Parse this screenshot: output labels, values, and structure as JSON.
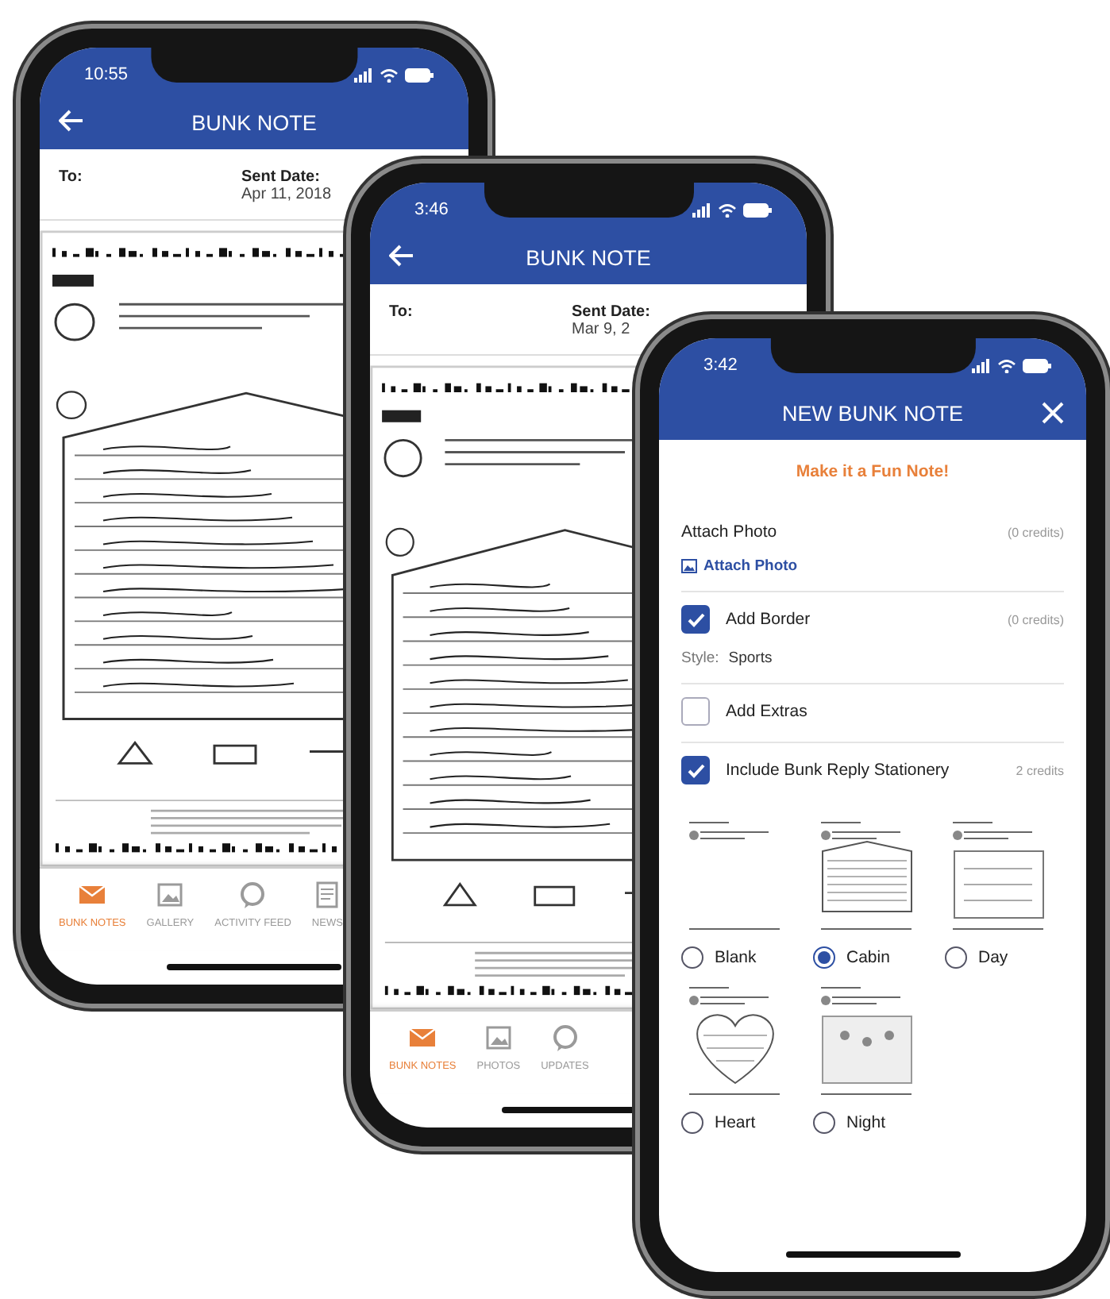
{
  "phones": [
    {
      "kind": "note",
      "time": "10:55",
      "title": "BUNK NOTE",
      "to_label": "To:",
      "sent_label": "Sent Date:",
      "sent_date": "Apr 11, 2018",
      "tabs": [
        {
          "kind": "mail",
          "label": "BUNK NOTES",
          "selected": true
        },
        {
          "kind": "image",
          "label": "GALLERY",
          "selected": false
        },
        {
          "kind": "chat",
          "label": "ACTIVITY FEED",
          "selected": false
        },
        {
          "kind": "news",
          "label": "NEWS",
          "selected": false
        }
      ]
    },
    {
      "kind": "note",
      "time": "3:46",
      "title": "BUNK NOTE",
      "to_label": "To:",
      "sent_label": "Sent Date:",
      "sent_date": "Mar 9, 2",
      "tabs": [
        {
          "kind": "mail",
          "label": "BUNK NOTES",
          "selected": true
        },
        {
          "kind": "image",
          "label": "PHOTOS",
          "selected": false
        },
        {
          "kind": "chat",
          "label": "UPDATES",
          "selected": false
        }
      ]
    },
    {
      "kind": "new_note",
      "time": "3:42",
      "title": "NEW BUNK NOTE",
      "heading": "Make it a Fun Note!",
      "sections": [
        {
          "kind": "photo",
          "label": "Attach Photo",
          "credits": "(0 credits)",
          "link": "Attach Photo"
        },
        {
          "kind": "check",
          "label": "Add Border",
          "checked": true,
          "credits": "(0 credits)",
          "style_label": "Style:",
          "style_value": "Sports"
        },
        {
          "kind": "check",
          "label": "Add Extras",
          "checked": false
        },
        {
          "kind": "check",
          "label": "Include Bunk Reply Stationery",
          "checked": true,
          "credits": "2 credits"
        }
      ],
      "stationery": [
        {
          "label": "Blank",
          "selected": false
        },
        {
          "label": "Cabin",
          "selected": true
        },
        {
          "label": "Day",
          "selected": false
        },
        {
          "label": "Heart",
          "selected": false
        },
        {
          "label": "Night",
          "selected": false
        }
      ]
    }
  ]
}
